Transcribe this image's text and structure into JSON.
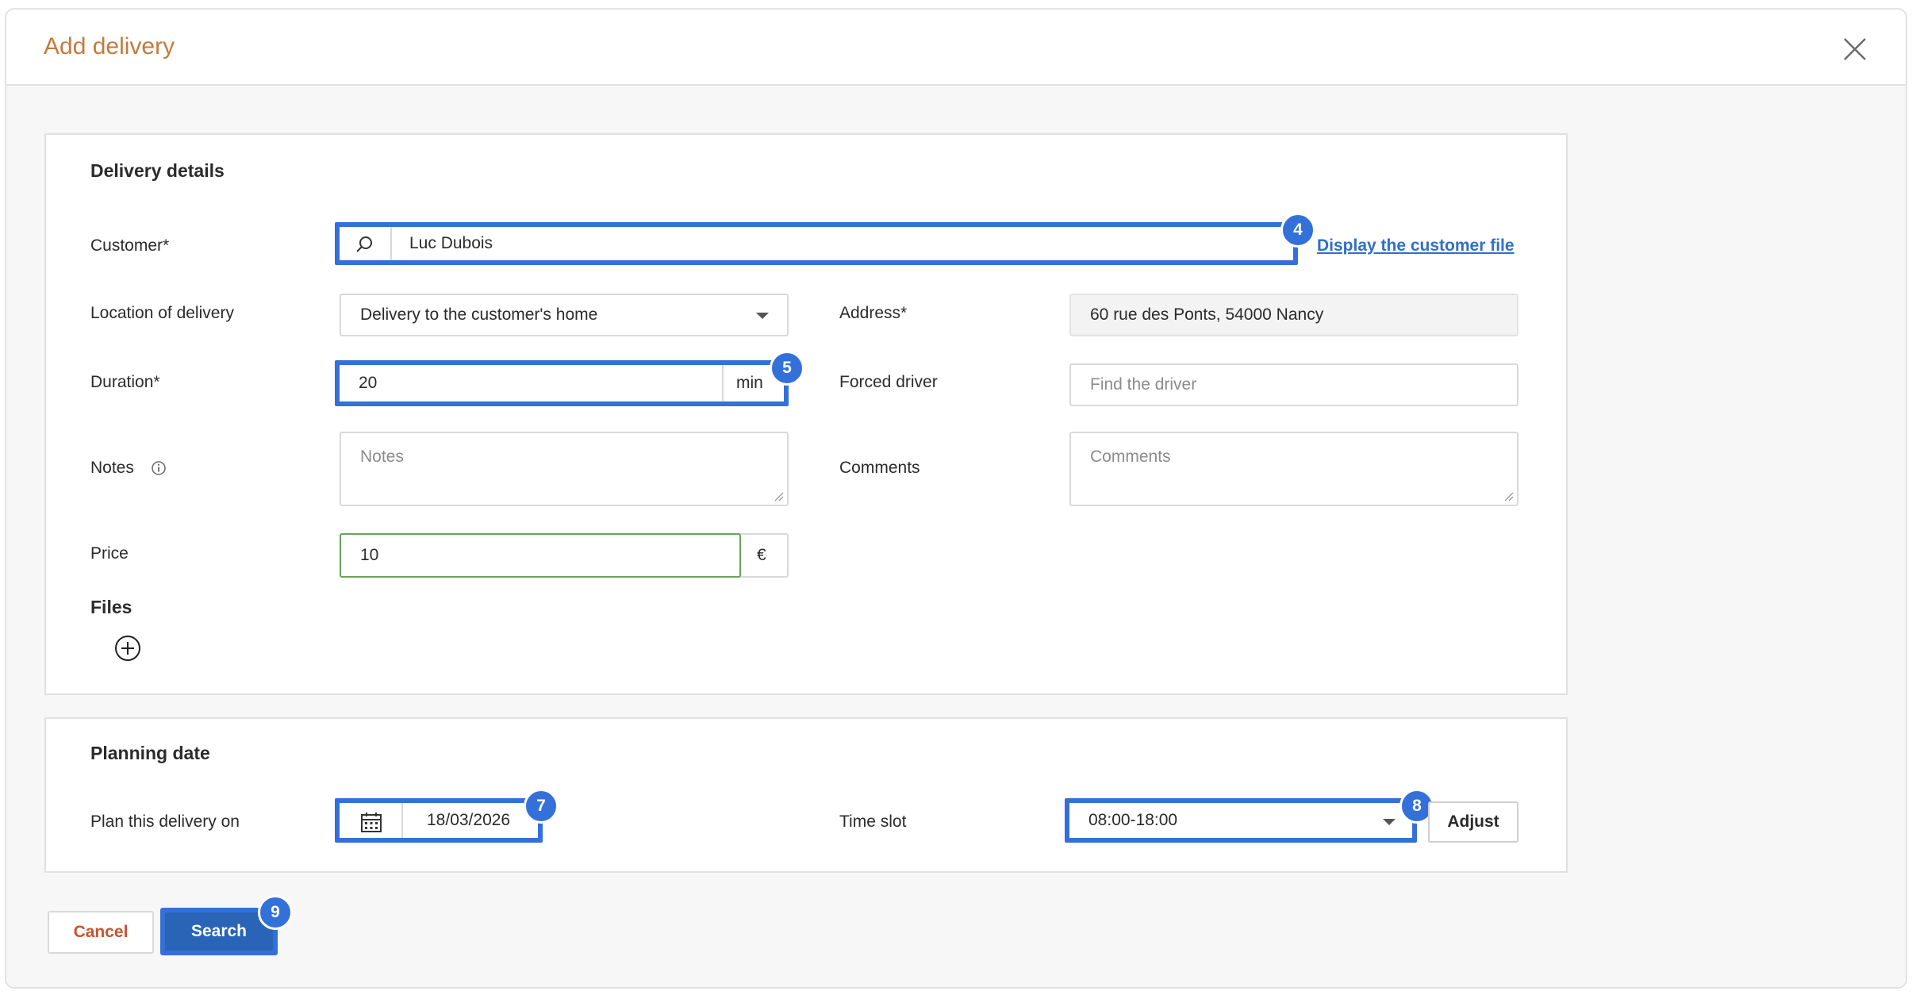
{
  "dialog": {
    "title": "Add delivery"
  },
  "delivery_details": {
    "section_title": "Delivery details",
    "customer": {
      "label": "Customer*",
      "value": "Luc Dubois",
      "badge": "4",
      "link": "Display the customer file"
    },
    "location": {
      "label": "Location of delivery",
      "value": "Delivery to the customer's home"
    },
    "address": {
      "label": "Address*",
      "value": "60 rue des Ponts, 54000 Nancy"
    },
    "duration": {
      "label": "Duration*",
      "value": "20",
      "unit": "min",
      "badge": "5"
    },
    "forced_driver": {
      "label": "Forced driver",
      "placeholder": "Find the driver"
    },
    "notes": {
      "label": "Notes",
      "placeholder": "Notes"
    },
    "comments": {
      "label": "Comments",
      "placeholder": "Comments"
    },
    "price": {
      "label": "Price",
      "value": "10",
      "unit": "€"
    },
    "files": {
      "label": "Files"
    }
  },
  "planning": {
    "section_title": "Planning date",
    "plan_on": {
      "label": "Plan this delivery on",
      "value": "18/03/2026",
      "badge": "7"
    },
    "time_slot": {
      "label": "Time slot",
      "value": "08:00-18:00",
      "badge": "8"
    },
    "adjust_label": "Adjust"
  },
  "footer": {
    "cancel_label": "Cancel",
    "search_label": "Search",
    "search_badge": "9"
  },
  "colors": {
    "title": "#c57a3d",
    "highlight": "#3470d9",
    "link": "#2f6fc6",
    "cancel_text": "#c9532f",
    "search_bg": "#2a64b7",
    "price_border": "#6aa35c"
  },
  "icons": [
    "close-icon",
    "search-icon",
    "chevron-down-icon",
    "info-icon",
    "add-circle-icon",
    "calendar-icon"
  ]
}
